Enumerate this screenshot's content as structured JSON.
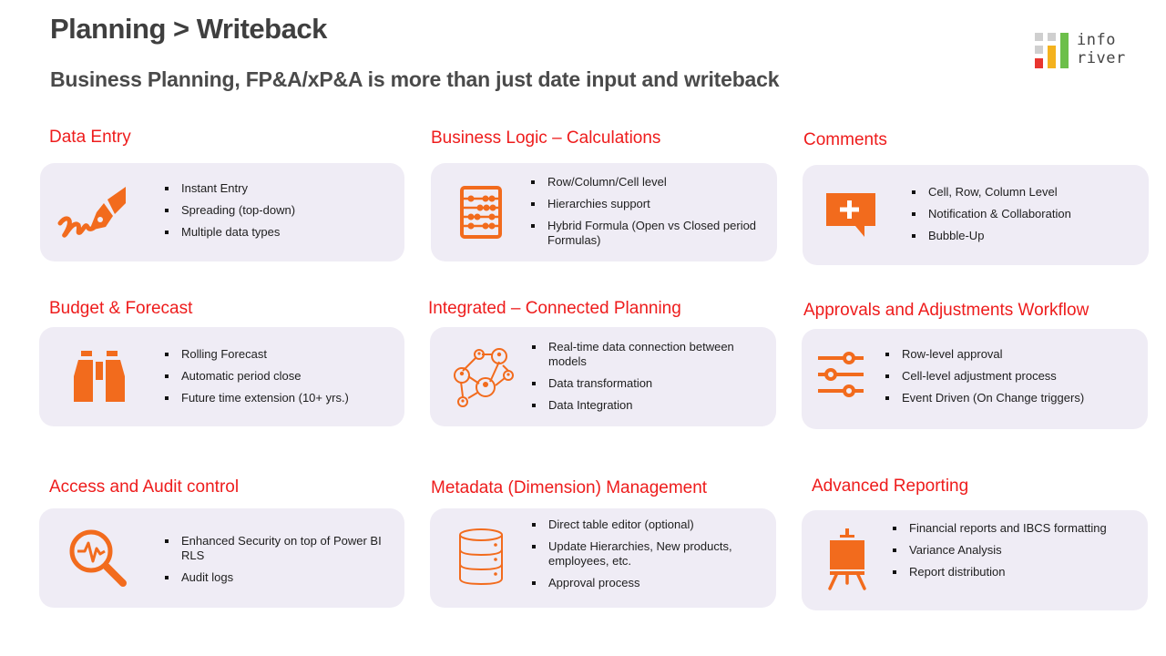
{
  "header": {
    "title": "Planning > Writeback",
    "subtitle": "Business Planning, FP&A/xP&A is more than just date input and writeback"
  },
  "logo": {
    "line1": "info",
    "line2": "river",
    "colors": {
      "gray": "#cfcfcf",
      "red": "#e8352f",
      "yellow": "#f4b21e",
      "green": "#6cbf4a"
    }
  },
  "theme": {
    "accent": "#f26b1d",
    "heading": "#ee1c1c",
    "card_bg": "#efecf5"
  },
  "sections": [
    {
      "heading": "Data Entry",
      "icon": "pen-signature-icon",
      "items": [
        "Instant Entry",
        "Spreading (top-down)",
        "Multiple data types"
      ]
    },
    {
      "heading": "Business Logic – Calculations",
      "icon": "abacus-icon",
      "items": [
        "Row/Column/Cell level",
        "Hierarchies support",
        "Hybrid Formula (Open vs Closed period Formulas)"
      ]
    },
    {
      "heading": "Comments",
      "icon": "comment-add-icon",
      "items": [
        "Cell, Row, Column Level",
        "Notification &  Collaboration",
        "Bubble-Up"
      ]
    },
    {
      "heading": "Budget & Forecast",
      "icon": "binoculars-icon",
      "items": [
        "Rolling Forecast",
        "Automatic period close",
        "Future time extension (10+ yrs.)"
      ]
    },
    {
      "heading": "Integrated – Connected Planning",
      "icon": "network-users-icon",
      "items": [
        "Real-time data connection between models",
        "Data transformation",
        "Data Integration"
      ]
    },
    {
      "heading": "Approvals and Adjustments Workflow",
      "icon": "sliders-icon",
      "items": [
        "Row-level approval",
        "Cell-level adjustment process",
        "Event Driven (On Change triggers)"
      ]
    },
    {
      "heading": "Access and Audit control",
      "icon": "magnifier-pulse-icon",
      "items": [
        "Enhanced Security on top of Power BI RLS",
        "Audit logs"
      ]
    },
    {
      "heading": "Metadata (Dimension) Management",
      "icon": "database-icon",
      "items": [
        "Direct table editor (optional)",
        "Update Hierarchies, New products, employees, etc.",
        "Approval process"
      ]
    },
    {
      "heading": "Advanced Reporting",
      "icon": "easel-icon",
      "items": [
        "Financial reports and IBCS formatting",
        "Variance Analysis",
        "Report distribution"
      ]
    }
  ]
}
